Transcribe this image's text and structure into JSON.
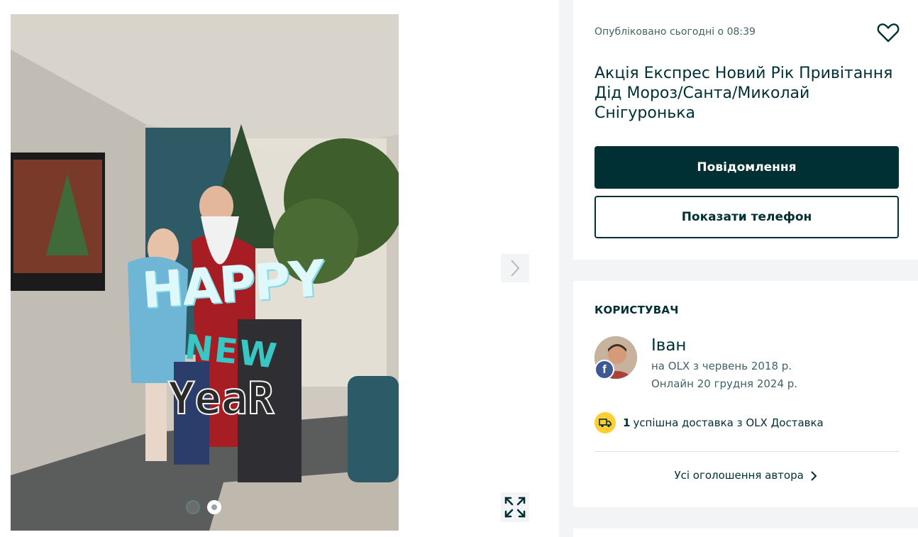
{
  "listing": {
    "published": "Опубліковано сьогодні о 08:39",
    "title": "Акція Експрес Новий Рік Привітання Дід Мороз/Санта/Миколай Снігуронька",
    "message_button": "Повідомлення",
    "phone_button": "Показати телефон"
  },
  "gallery": {
    "overlay_happy": "HAPPY",
    "overlay_new": "NEW",
    "overlay_year": "YeaR",
    "slides_total": 2,
    "slide_active": 2
  },
  "user": {
    "section_title": "КОРИСТУВАЧ",
    "name": "Іван",
    "since": "на OLX з червень 2018 р.",
    "online": "Онлайн 20 грудня 2024 р.",
    "delivery_count": "1",
    "delivery_text": "успішна доставка з OLX Доставка",
    "all_ads": "Усі оголошення автора"
  },
  "icons": {
    "favorite": "heart-icon",
    "next": "chevron-right-icon",
    "expand": "expand-icon",
    "delivery": "truck-icon",
    "facebook": "facebook-icon"
  },
  "colors": {
    "primary": "#002f34",
    "accent_yellow": "#ffce32",
    "facebook": "#3b5998"
  }
}
